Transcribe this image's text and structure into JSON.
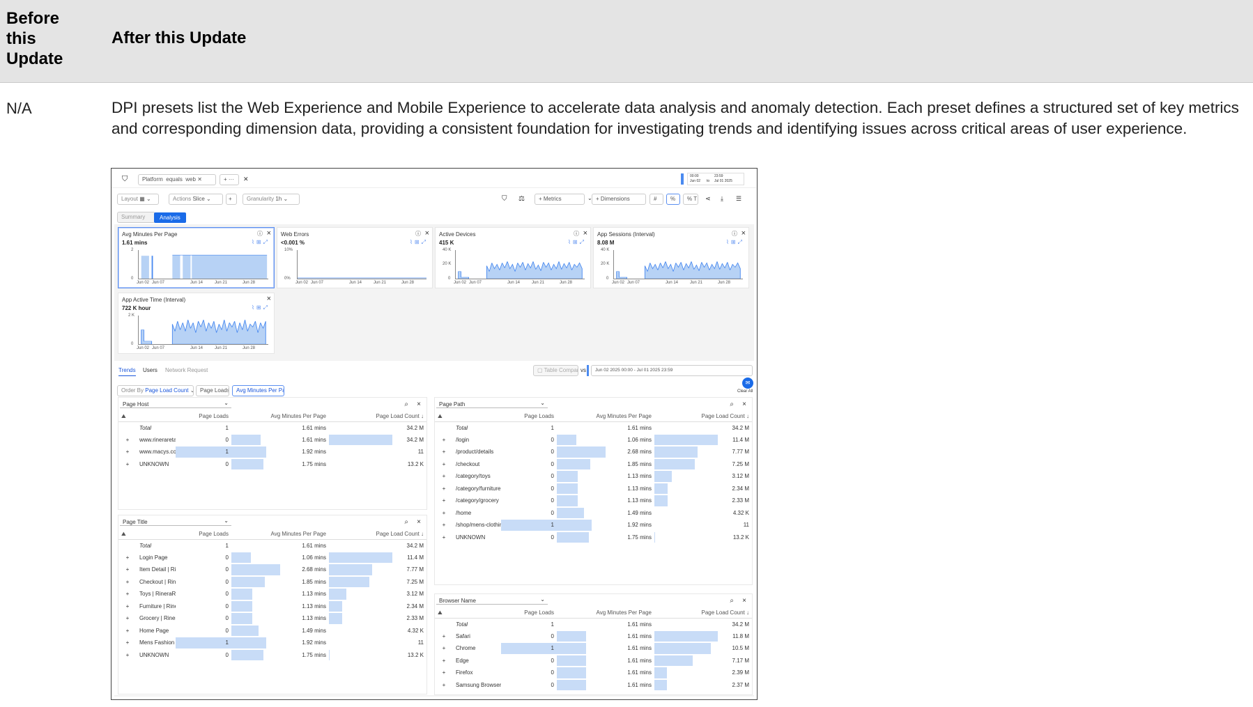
{
  "table": {
    "before_header": "Before this Update",
    "after_header": "After this Update",
    "before_value": "N/A",
    "description": "DPI presets list the Web Experience and Mobile Experience to accelerate data analysis and anomaly detection. Each preset defines a structured set of key metrics and corresponding dimension data, providing a consistent foundation for investigating trends and identifying issues across critical areas of user experience."
  },
  "app": {
    "filter": {
      "field": "Platform",
      "op": "equals",
      "value": "web",
      "more": "+ ···"
    },
    "date": {
      "from_time": "00:00",
      "from_date": "Jun 02",
      "to": "to",
      "to_time": "23:59",
      "to_date": "Jul 01 2025"
    },
    "toolbar": {
      "layout_label": "Layout",
      "actions_label": "Actions",
      "actions_value": "Slice",
      "gran_label": "Granularity",
      "gran_value": "1h",
      "metrics": "+ Metrics",
      "dimensions": "+ Dimensions",
      "hash": "#",
      "pct": "%",
      "pctT": "% T"
    },
    "view_tabs": {
      "summary": "Summary",
      "analysis": "Analysis"
    },
    "x_ticks": [
      "Jun 02",
      "Jun 07",
      "Jun 14",
      "Jun 21",
      "Jun 28"
    ],
    "cards": [
      {
        "title": "Avg Minutes Per Page",
        "value": "1.61 mins",
        "ymax": "2",
        "ymin": "0"
      },
      {
        "title": "Web Errors",
        "value": "<0.001 %",
        "ymax": "10%",
        "ymin": "0%"
      },
      {
        "title": "Active Devices",
        "value": "415 K",
        "ymax": "40 K",
        "ymid": "20 K",
        "ymin": "0"
      },
      {
        "title": "App Sessions (Interval)",
        "value": "8.08 M",
        "ymax": "40 K",
        "ymid": "20 K",
        "ymin": "0"
      },
      {
        "title": "App Active Time (Interval)",
        "value": "722 K hour",
        "ymax": "2 K",
        "ymin": "0"
      }
    ],
    "bottom_tabs": {
      "trends": "Trends",
      "users": "Users",
      "network": "Network Request"
    },
    "compare": {
      "label": "Table Compare",
      "vs": "vs",
      "range": "Jun 02 2025 00:00 - Jul 01 2025 23:59",
      "clear": "Clear All"
    },
    "order": {
      "label": "Order By",
      "value": "Page Load Count",
      "chip1": "Page Loads",
      "chip2": "Avg Minutes Per Page"
    },
    "cols": {
      "c1": "Page Loads",
      "c2": "Avg Minutes Per Page",
      "c3": "Page Load Count ↓"
    },
    "tables": {
      "host": {
        "title": "Page Host",
        "rows": [
          {
            "name": "Total",
            "a": "1",
            "b": "1.61 mins",
            "c": "34.2 M"
          },
          {
            "name": "www.rineraretail.com",
            "a": "0",
            "b": "1.61 mins",
            "c": "34.2 M"
          },
          {
            "name": "www.macys.com",
            "a": "1",
            "b": "1.92 mins",
            "c": "11"
          },
          {
            "name": "UNKNOWN",
            "a": "0",
            "b": "1.75 mins",
            "c": "13.2 K"
          }
        ]
      },
      "path": {
        "title": "Page Path",
        "rows": [
          {
            "name": "Total",
            "a": "1",
            "b": "1.61 mins",
            "c": "34.2 M"
          },
          {
            "name": "/login",
            "a": "0",
            "b": "1.06 mins",
            "c": "11.4 M"
          },
          {
            "name": "/product/details",
            "a": "0",
            "b": "2.68 mins",
            "c": "7.77 M"
          },
          {
            "name": "/checkout",
            "a": "0",
            "b": "1.85 mins",
            "c": "7.25 M"
          },
          {
            "name": "/category/toys",
            "a": "0",
            "b": "1.13 mins",
            "c": "3.12 M"
          },
          {
            "name": "/category/furniture",
            "a": "0",
            "b": "1.13 mins",
            "c": "2.34 M"
          },
          {
            "name": "/category/grocery",
            "a": "0",
            "b": "1.13 mins",
            "c": "2.33 M"
          },
          {
            "name": "/home",
            "a": "0",
            "b": "1.49 mins",
            "c": "4.32 K"
          },
          {
            "name": "/shop/mens-clothing",
            "a": "1",
            "b": "1.92 mins",
            "c": "11"
          },
          {
            "name": "UNKNOWN",
            "a": "0",
            "b": "1.75 mins",
            "c": "13.2 K"
          }
        ]
      },
      "title": {
        "title": "Page Title",
        "rows": [
          {
            "name": "Total",
            "a": "1",
            "b": "1.61 mins",
            "c": "34.2 M"
          },
          {
            "name": "Login Page",
            "a": "0",
            "b": "1.06 mins",
            "c": "11.4 M"
          },
          {
            "name": "Item Detail | RineraRetail",
            "a": "0",
            "b": "2.68 mins",
            "c": "7.77 M"
          },
          {
            "name": "Checkout | RineraRetail",
            "a": "0",
            "b": "1.85 mins",
            "c": "7.25 M"
          },
          {
            "name": "Toys | RineraRetail",
            "a": "0",
            "b": "1.13 mins",
            "c": "3.12 M"
          },
          {
            "name": "Furniture | RineraRetail",
            "a": "0",
            "b": "1.13 mins",
            "c": "2.34 M"
          },
          {
            "name": "Grocery | RineraRetail",
            "a": "0",
            "b": "1.13 mins",
            "c": "2.33 M"
          },
          {
            "name": "Home Page",
            "a": "0",
            "b": "1.49 mins",
            "c": "4.32 K"
          },
          {
            "name": "Mens Fashion & Accessories - M...",
            "a": "1",
            "b": "1.92 mins",
            "c": "11"
          },
          {
            "name": "UNKNOWN",
            "a": "0",
            "b": "1.75 mins",
            "c": "13.2 K"
          }
        ]
      },
      "browser": {
        "title": "Browser Name",
        "rows": [
          {
            "name": "Total",
            "a": "1",
            "b": "1.61 mins",
            "c": "34.2 M"
          },
          {
            "name": "Safari",
            "a": "0",
            "b": "1.61 mins",
            "c": "11.8 M"
          },
          {
            "name": "Chrome",
            "a": "1",
            "b": "1.61 mins",
            "c": "10.5 M"
          },
          {
            "name": "Edge",
            "a": "0",
            "b": "1.61 mins",
            "c": "7.17 M"
          },
          {
            "name": "Firefox",
            "a": "0",
            "b": "1.61 mins",
            "c": "2.39 M"
          },
          {
            "name": "Samsung Browser",
            "a": "0",
            "b": "1.61 mins",
            "c": "2.37 M"
          }
        ]
      }
    }
  }
}
